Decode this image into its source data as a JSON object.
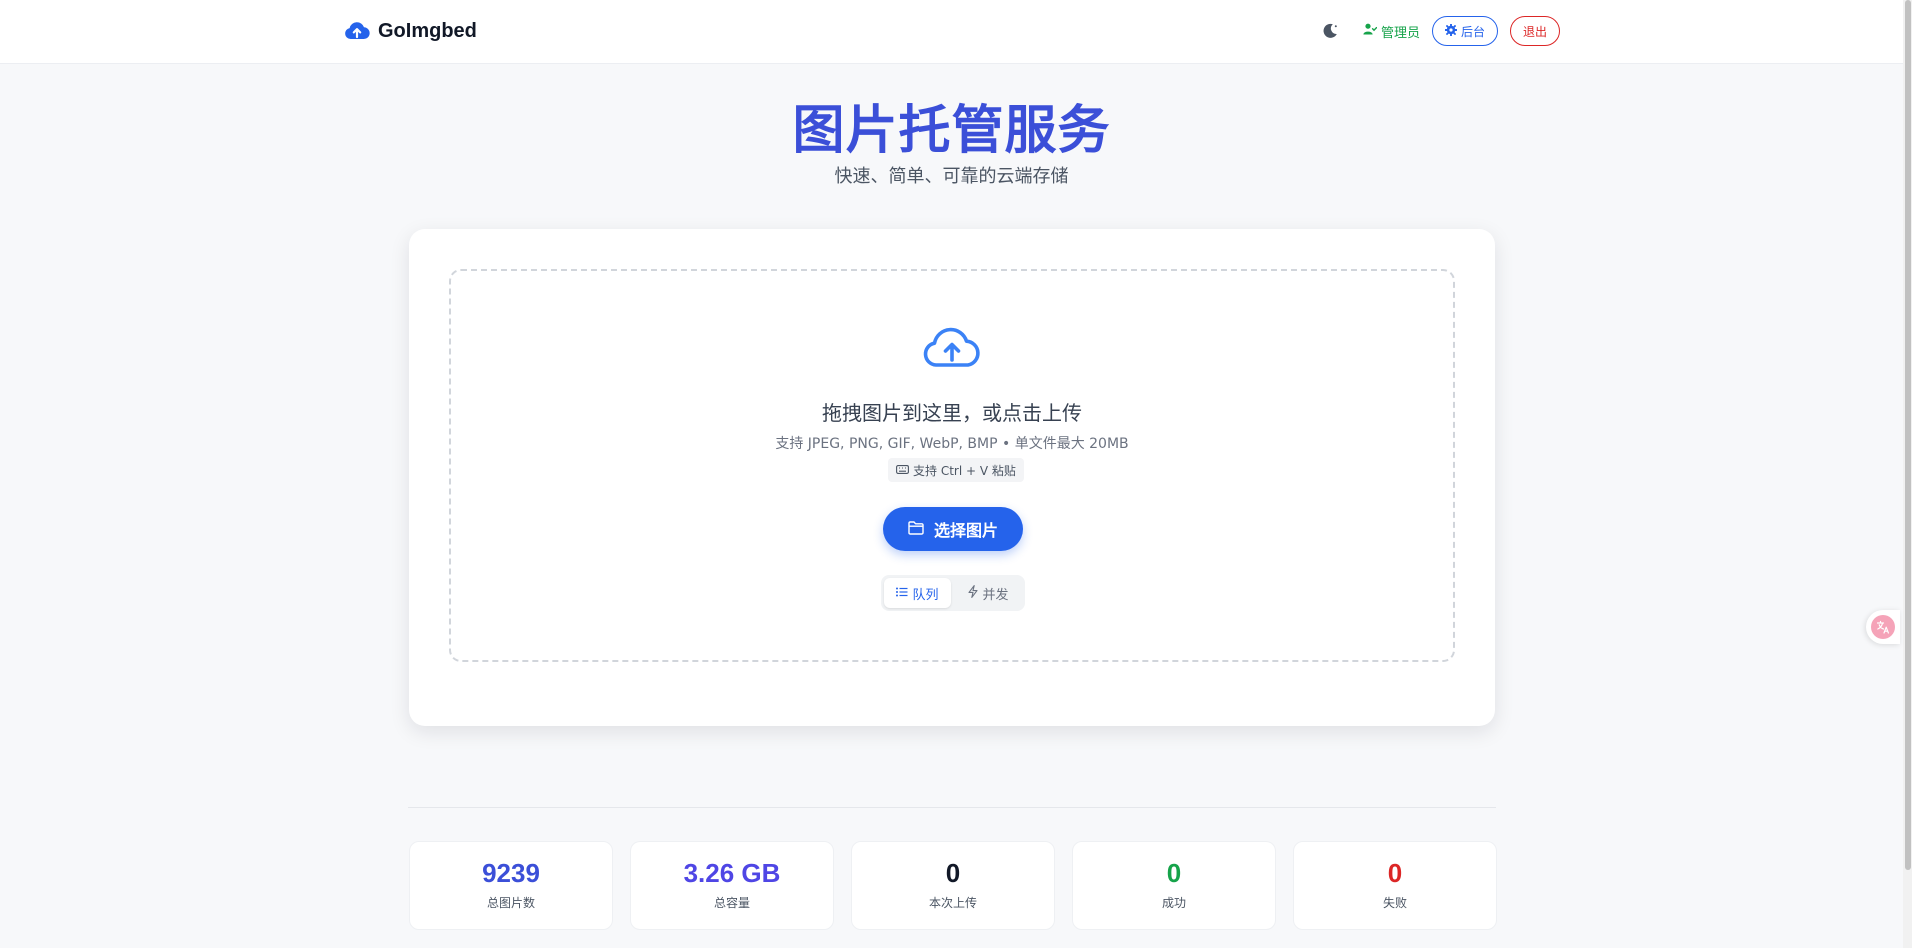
{
  "header": {
    "brand": "GoImgbed",
    "user_label": "管理员",
    "admin_button": "后台",
    "logout_button": "退出"
  },
  "hero": {
    "title": "图片托管服务",
    "subtitle": "快速、简单、可靠的云端存储"
  },
  "upload": {
    "title": "拖拽图片到这里，或点击上传",
    "hint": "支持 JPEG, PNG, GIF, WebP, BMP  •  单文件最大 20MB",
    "paste_hint": "支持 Ctrl + V 粘贴",
    "select_button": "选择图片",
    "modes": [
      {
        "label": "队列",
        "active": true
      },
      {
        "label": "并发",
        "active": false
      }
    ]
  },
  "stats": [
    {
      "value": "9239",
      "label": "总图片数",
      "color": "#3b4fd8"
    },
    {
      "value": "3.26 GB",
      "label": "总容量",
      "color": "#4f46e5"
    },
    {
      "value": "0",
      "label": "本次上传",
      "color": "#111827"
    },
    {
      "value": "0",
      "label": "成功",
      "color": "#16a34a"
    },
    {
      "value": "0",
      "label": "失败",
      "color": "#dc2626"
    }
  ],
  "colors": {
    "accent": "#2563eb",
    "title": "#3b4fd8",
    "success": "#16a34a",
    "danger": "#dc2626"
  },
  "icons": {
    "brand": "cloud-upload-icon",
    "theme": "moon-icon",
    "user": "user-check-icon",
    "admin": "gear-icon",
    "upload": "cloud-upload-icon",
    "paste": "keyboard-icon",
    "select": "folder-icon",
    "queue": "list-icon",
    "concurrent": "lightning-icon",
    "translate": "translate-icon"
  }
}
